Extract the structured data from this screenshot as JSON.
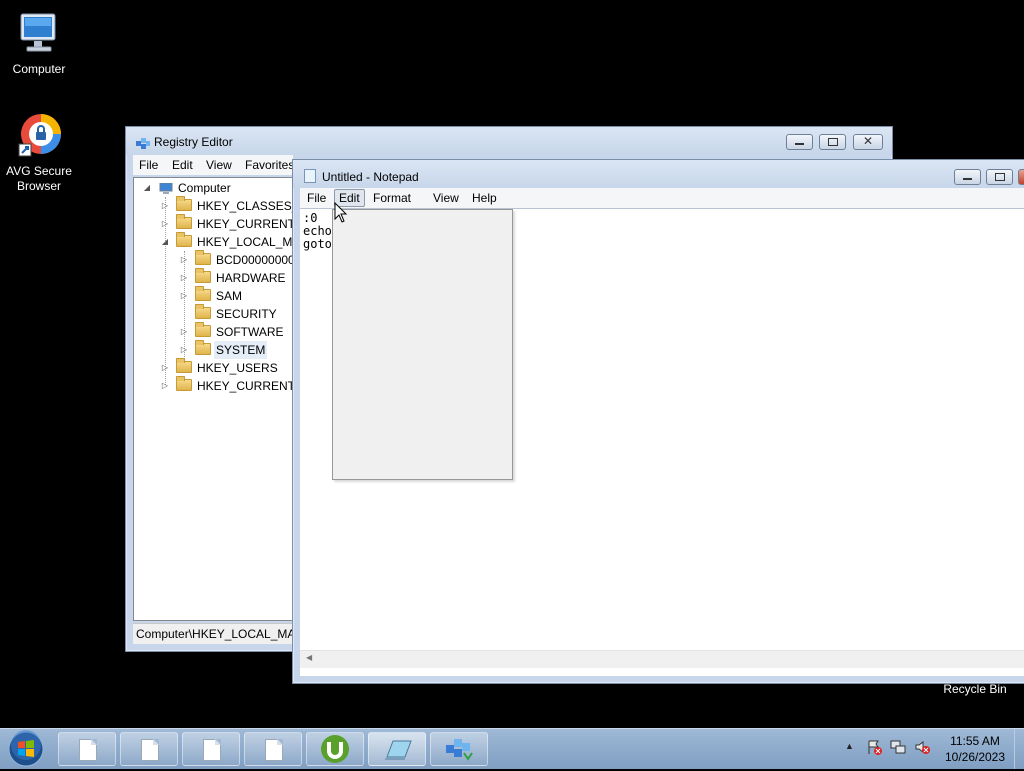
{
  "desktop": {
    "icons": [
      {
        "label": "Computer",
        "icon": "computer-icon"
      },
      {
        "label": "AVG Secure\nBrowser",
        "icon": "avg-browser-icon"
      },
      {
        "label": "Recycle Bin",
        "icon": "recycle-bin-icon"
      }
    ]
  },
  "regedit": {
    "title": "Registry Editor",
    "menu": [
      "File",
      "Edit",
      "View",
      "Favorites"
    ],
    "tree": {
      "root": "Computer",
      "items": [
        {
          "label": "HKEY_CLASSES_RO",
          "expander": "collapsed"
        },
        {
          "label": "HKEY_CURRENT_U",
          "expander": "collapsed"
        },
        {
          "label": "HKEY_LOCAL_MA",
          "expander": "expanded"
        },
        {
          "label": "BCD00000000",
          "expander": "collapsed"
        },
        {
          "label": "HARDWARE",
          "expander": "collapsed"
        },
        {
          "label": "SAM",
          "expander": "collapsed"
        },
        {
          "label": "SECURITY",
          "expander": "none"
        },
        {
          "label": "SOFTWARE",
          "expander": "collapsed"
        },
        {
          "label": "SYSTEM",
          "expander": "collapsed",
          "selected": true
        },
        {
          "label": "HKEY_USERS",
          "expander": "collapsed"
        },
        {
          "label": "HKEY_CURRENT_C",
          "expander": "collapsed"
        }
      ]
    },
    "status": "Computer\\HKEY_LOCAL_MAC"
  },
  "notepad": {
    "title": "Untitled - Notepad",
    "menu": [
      "File",
      "Edit",
      "Format",
      "View",
      "Help"
    ],
    "active_menu": "Edit",
    "content_lines": [
      ":0",
      "echo",
      "goto"
    ]
  },
  "taskbar": {
    "clock_time": "11:55 AM",
    "clock_date": "10/26/2023",
    "buttons": [
      "document-icon",
      "document-icon",
      "document-icon",
      "document-icon",
      "utorrent-icon",
      "notepad-icon",
      "regedit-icon"
    ]
  },
  "colors": {
    "desktop_bg": "#000000",
    "selection": "#cde8ff",
    "taskbar": "#8fadcd"
  }
}
